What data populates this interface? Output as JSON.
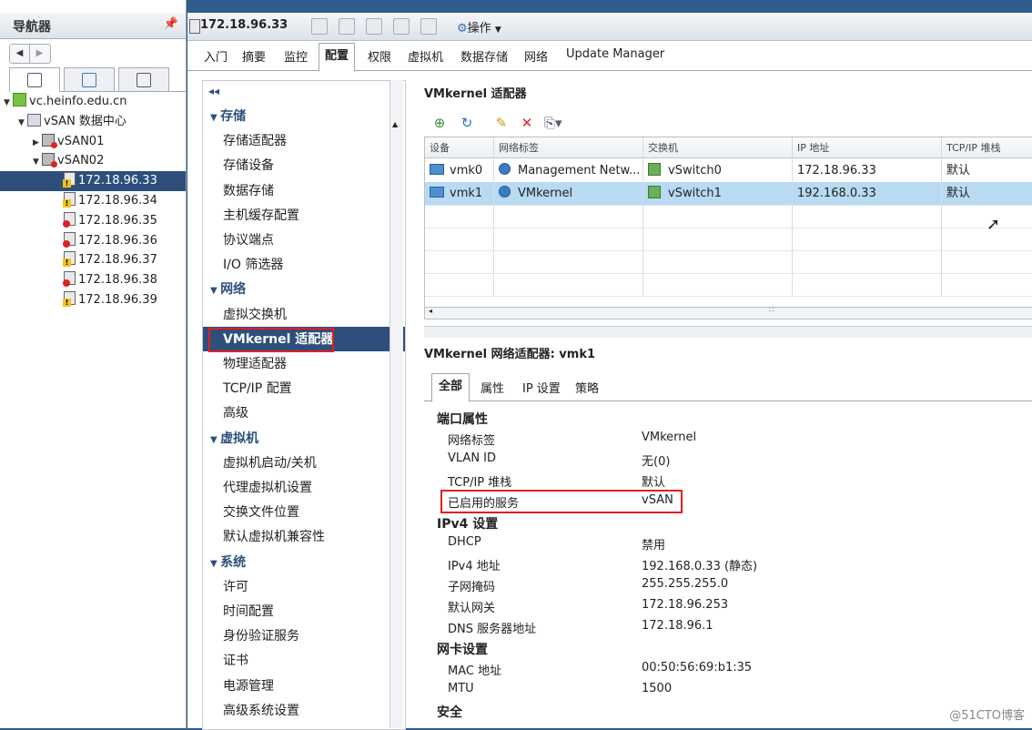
{
  "navigator": {
    "title": "导航器",
    "tree": [
      {
        "label": "vc.heinfo.edu.cn",
        "type": "vcenter",
        "depth": 0
      },
      {
        "label": "vSAN 数据中心",
        "type": "datacenter",
        "depth": 1
      },
      {
        "label": "vSAN01",
        "type": "cluster",
        "depth": 2
      },
      {
        "label": "vSAN02",
        "type": "cluster",
        "depth": 2
      },
      {
        "label": "172.18.96.33",
        "type": "host-warn",
        "depth": 3,
        "selected": true
      },
      {
        "label": "172.18.96.34",
        "type": "host-warn",
        "depth": 3
      },
      {
        "label": "172.18.96.35",
        "type": "host-err",
        "depth": 3
      },
      {
        "label": "172.18.96.36",
        "type": "host-err",
        "depth": 3
      },
      {
        "label": "172.18.96.37",
        "type": "host-warn",
        "depth": 3
      },
      {
        "label": "172.18.96.38",
        "type": "host-err",
        "depth": 3
      },
      {
        "label": "172.18.96.39",
        "type": "host-warn",
        "depth": 3
      }
    ]
  },
  "header": {
    "host_title": "172.18.96.33",
    "actions_label": "操作"
  },
  "tabs": [
    "入门",
    "摘要",
    "监控",
    "配置",
    "权限",
    "虚拟机",
    "数据存储",
    "网络",
    "Update Manager"
  ],
  "menu": {
    "sections": [
      {
        "title": "存储",
        "items": [
          "存储适配器",
          "存储设备",
          "数据存储",
          "主机缓存配置",
          "协议端点",
          "I/O 筛选器"
        ]
      },
      {
        "title": "网络",
        "items": [
          "虚拟交换机",
          "VMkernel 适配器",
          "物理适配器",
          "TCP/IP 配置",
          "高级"
        ]
      },
      {
        "title": "虚拟机",
        "items": [
          "虚拟机启动/关机",
          "代理虚拟机设置",
          "交换文件位置",
          "默认虚拟机兼容性"
        ]
      },
      {
        "title": "系统",
        "items": [
          "许可",
          "时间配置",
          "身份验证服务",
          "证书",
          "电源管理",
          "高级系统设置"
        ]
      }
    ],
    "selected": "VMkernel 适配器"
  },
  "vmkernel": {
    "title": "VMkernel 适配器",
    "columns": [
      "设备",
      "网络标签",
      "交换机",
      "IP 地址",
      "TCP/IP 堆栈"
    ],
    "rows": [
      {
        "device": "vmk0",
        "label": "Management Netw...",
        "switch": "vSwitch0",
        "ip": "172.18.96.33",
        "stack": "默认"
      },
      {
        "device": "vmk1",
        "label": "VMkernel",
        "switch": "vSwitch1",
        "ip": "192.168.0.33",
        "stack": "默认",
        "selected": true
      }
    ]
  },
  "details": {
    "title": "VMkernel 网络适配器: vmk1",
    "tabs": [
      "全部",
      "属性",
      "IP 设置",
      "策略"
    ],
    "sections": [
      {
        "title": "端口属性",
        "props": [
          {
            "label": "网络标签",
            "value": "VMkernel"
          },
          {
            "label": "VLAN ID",
            "value": "无(0)"
          },
          {
            "label": "TCP/IP 堆栈",
            "value": "默认"
          },
          {
            "label": "已启用的服务",
            "value": "vSAN"
          }
        ]
      },
      {
        "title": "IPv4 设置",
        "props": [
          {
            "label": "DHCP",
            "value": "禁用"
          },
          {
            "label": "IPv4 地址",
            "value": "192.168.0.33 (静态)"
          },
          {
            "label": "子网掩码",
            "value": "255.255.255.0"
          },
          {
            "label": "默认网关",
            "value": "172.18.96.253"
          },
          {
            "label": "DNS 服务器地址",
            "value": "172.18.96.1"
          }
        ]
      },
      {
        "title": "网卡设置",
        "props": [
          {
            "label": "MAC 地址",
            "value": "00:50:56:69:b1:35"
          },
          {
            "label": "MTU",
            "value": "1500"
          }
        ]
      },
      {
        "title": "安全",
        "props": []
      }
    ]
  },
  "watermark": "@51CTO博客"
}
